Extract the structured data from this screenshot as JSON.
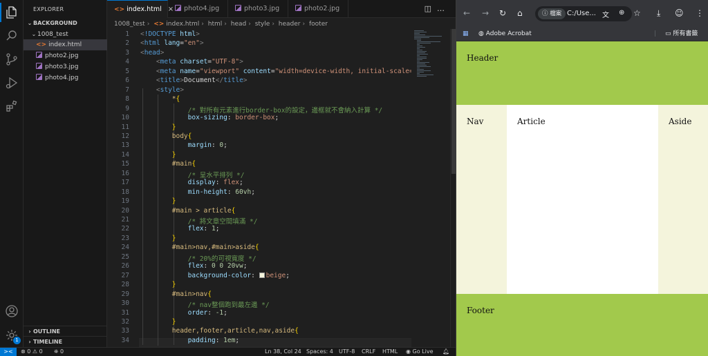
{
  "sidebar": {
    "title": "EXPLORER",
    "root": "BACKGROUND",
    "folder": "1008_test",
    "files": [
      "index.html",
      "photo2.jpg",
      "photo3.jpg",
      "photo4.jpg"
    ],
    "outline": "OUTLINE",
    "timeline": "TIMELINE"
  },
  "activity": {
    "account_badge": "1"
  },
  "tabs": [
    "index.html",
    "photo4.jpg",
    "photo3.jpg",
    "photo2.jpg"
  ],
  "breadcrumb": [
    "1008_test",
    "index.html",
    "html",
    "head",
    "style",
    "header",
    "footer"
  ],
  "code": {
    "line_numbers": [
      "1",
      "2",
      "3",
      "4",
      "5",
      "6",
      "7",
      "8",
      "9",
      "10",
      "11",
      "12",
      "13",
      "14",
      "15",
      "16",
      "17",
      "18",
      "19",
      "20",
      "21",
      "22",
      "23",
      "24",
      "25",
      "26",
      "27",
      "28",
      "29",
      "30",
      "31",
      "32",
      "33",
      "34"
    ]
  },
  "statusbar": {
    "errors": "0",
    "warnings": "0",
    "ports": "0",
    "position": "Ln 38, Col 24",
    "spaces": "Spaces: 4",
    "encoding": "UTF-8",
    "eol": "CRLF",
    "language": "HTML",
    "golive": "Go Live"
  },
  "browser": {
    "chip": "檔案",
    "url": "C:/Use...",
    "bookmark": "Adobe Acrobat",
    "all_bookmarks": "所有書籤"
  },
  "page": {
    "header": "Header",
    "nav": "Nav",
    "article": "Article",
    "aside": "Aside",
    "footer": "Footer"
  },
  "colors": {
    "accent": "#0078d4",
    "header_footer_bg": "#a2c94c",
    "nav_aside_bg": "#f4f4dc"
  }
}
